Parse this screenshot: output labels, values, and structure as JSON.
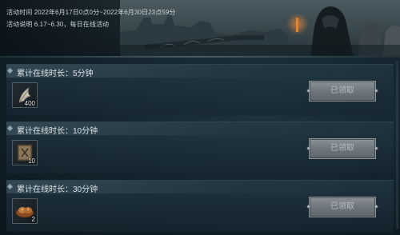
{
  "banner": {
    "time_label": "活动时间",
    "time_value": "2022年6月17日0点0分~2022年6月30日23点59分",
    "desc_label": "活动说明",
    "desc_value": "6.17~6.30，每日在线活动"
  },
  "tasks": [
    {
      "title": "累计在线时长：5分钟",
      "item_icon": "feather-item-icon",
      "item_count": "400",
      "button_label": "已领取"
    },
    {
      "title": "累计在线时长：10分钟",
      "item_icon": "scroll-book-icon",
      "item_count": "10",
      "button_label": "已领取"
    },
    {
      "title": "累计在线时长：30分钟",
      "item_icon": "bread-food-icon",
      "item_count": "2",
      "button_label": "已领取"
    }
  ]
}
